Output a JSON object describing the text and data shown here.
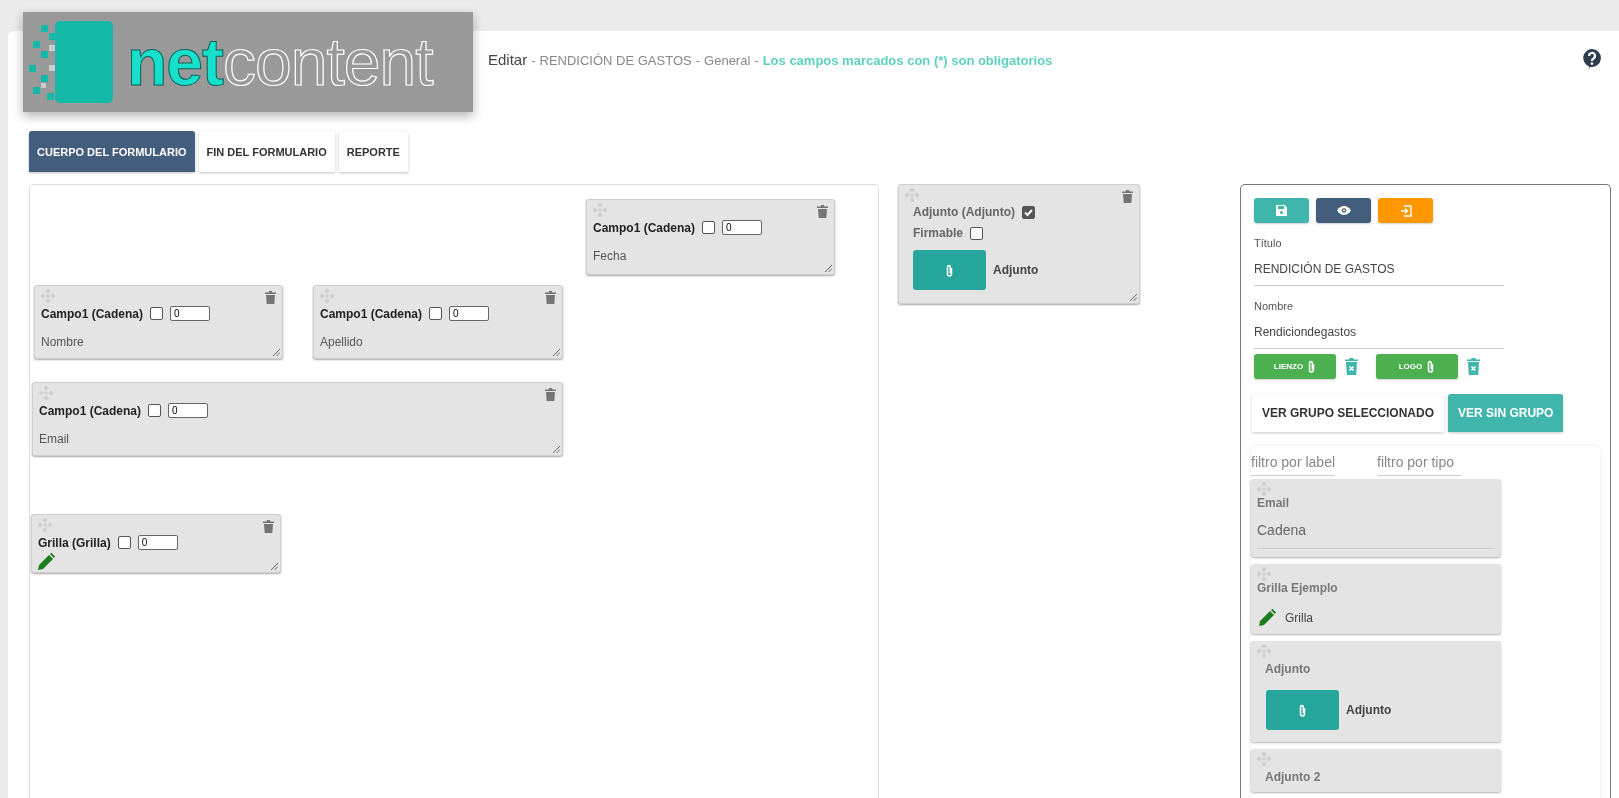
{
  "logo": {
    "text_primary": "net",
    "text_secondary": "content"
  },
  "title_parts": [
    {
      "kind": "action",
      "text": "Editar"
    },
    {
      "kind": "separator",
      "text": "-"
    },
    {
      "kind": "info",
      "text": "RENDICIÓN DE GASTOS"
    },
    {
      "kind": "separator",
      "text": "-"
    },
    {
      "kind": "info",
      "text": "General"
    },
    {
      "kind": "separator",
      "text": "-"
    },
    {
      "kind": "note",
      "text": "Los campos marcados con (*) son obligatorios"
    }
  ],
  "tabs": [
    {
      "label": "CUERPO DEL FORMULARIO",
      "selected": true
    },
    {
      "label": "FIN DEL FORMULARIO",
      "selected": false
    },
    {
      "label": "REPORTE",
      "selected": false
    }
  ],
  "canvas": {
    "fields": [
      {
        "kind": "field",
        "title": "Campo1 (Cadena)",
        "checked": false,
        "order": "0",
        "label": "Fecha"
      },
      {
        "kind": "field",
        "title": "Campo1 (Cadena)",
        "checked": false,
        "order": "0",
        "label": "Nombre"
      },
      {
        "kind": "field",
        "title": "Campo1 (Cadena)",
        "checked": false,
        "order": "0",
        "label": "Apellido"
      },
      {
        "kind": "field",
        "title": "Campo1 (Cadena)",
        "checked": false,
        "order": "0",
        "label": "Email"
      },
      {
        "kind": "grid",
        "title": "Grilla (Grilla)",
        "checked": false,
        "order": "0"
      }
    ]
  },
  "attachment_card": {
    "title": "Adjunto (Adjunto)",
    "checked": true,
    "signable_label": "Firmable",
    "signable": false,
    "button_label": "Adjunto"
  },
  "panel": {
    "toolbar": [
      {
        "kind": "save"
      },
      {
        "kind": "preview"
      },
      {
        "kind": "exit"
      }
    ],
    "title_field": {
      "label": "Título",
      "value": "RENDICIÓN DE GASTOS"
    },
    "name_field": {
      "label": "Nombre",
      "value": "Rendiciondegastos"
    },
    "uploads": [
      {
        "label": "LIENZO"
      },
      {
        "label": "LOGO"
      }
    ],
    "group_toggle": [
      {
        "label": "VER GRUPO SELECCIONADO",
        "selected": false
      },
      {
        "label": "VER SIN GRUPO",
        "selected": true
      }
    ],
    "filters": [
      {
        "placeholder": "filtro por label"
      },
      {
        "placeholder": "filtro por tipo"
      }
    ],
    "items": [
      {
        "kind": "text",
        "title": "Email",
        "value": "Cadena"
      },
      {
        "kind": "grid",
        "title": "Grilla Ejemplo",
        "value": "Grilla"
      },
      {
        "kind": "attachment",
        "title": "Adjunto",
        "value": "Adjunto"
      },
      {
        "kind": "attachment",
        "title": "Adjunto 2"
      }
    ]
  }
}
